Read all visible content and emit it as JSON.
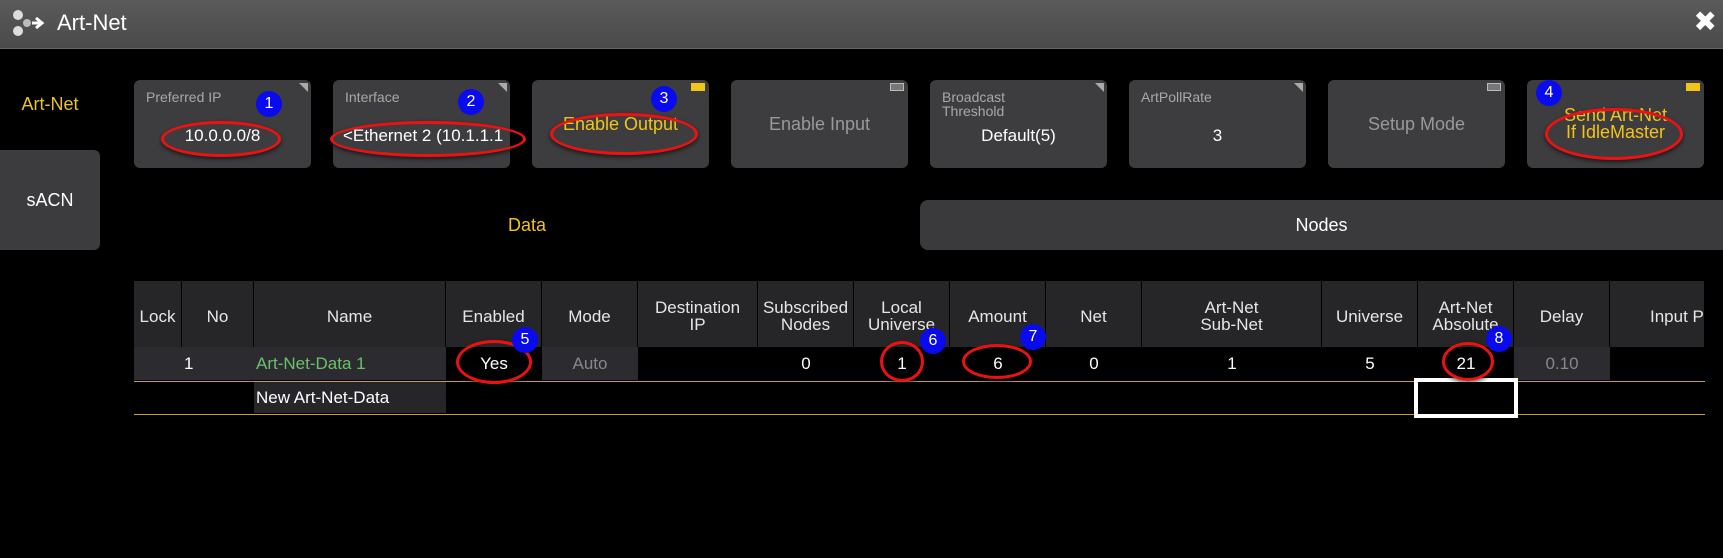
{
  "window": {
    "title": "Art-Net",
    "icon": "art-net-app-icon",
    "close": "✖"
  },
  "sidebar": {
    "items": [
      {
        "label": "Art-Net",
        "active": true
      },
      {
        "label": "sACN",
        "active": false
      }
    ]
  },
  "buttons": {
    "preferred_ip": {
      "label": "Preferred IP",
      "value": "10.0.0.0/8"
    },
    "interface": {
      "label": "Interface",
      "value": "<Ethernet 2 (10.1.1.1"
    },
    "enable_output": {
      "label": "Enable Output",
      "state": "on"
    },
    "enable_input": {
      "label": "Enable Input",
      "state": "off"
    },
    "broadcast_threshold": {
      "label": "Broadcast Threshold",
      "value": "Default(5)"
    },
    "artpoll_rate": {
      "label": "ArtPollRate",
      "value": "3"
    },
    "setup_mode": {
      "label": "Setup Mode",
      "state": "off"
    },
    "send_artnet": {
      "label_line1": "Send Art-Net",
      "label_line2": "If IdleMaster",
      "state": "on"
    }
  },
  "tabs": {
    "data": "Data",
    "nodes": "Nodes"
  },
  "table": {
    "headers": {
      "lock": "Lock",
      "no": "No",
      "name": "Name",
      "enabled": "Enabled",
      "mode": "Mode",
      "dest_ip_1": "Destination",
      "dest_ip_2": "IP",
      "subscribed_1": "Subscribed",
      "subscribed_2": "Nodes",
      "local_universe_1": "Local",
      "local_universe_2": "Universe",
      "amount": "Amount",
      "net": "Net",
      "subnet_1": "Art-Net",
      "subnet_2": "Sub-Net",
      "universe": "Universe",
      "absolute_1": "Art-Net",
      "absolute_2": "Absolute",
      "delay": "Delay",
      "input_p": "Input P"
    },
    "row": {
      "lock": "",
      "no": "1",
      "name": "Art-Net-Data 1",
      "enabled": "Yes",
      "mode": "Auto",
      "destination_ip": "",
      "subscribed_nodes": "0",
      "local_universe": "1",
      "amount": "6",
      "net": "0",
      "sub_net": "1",
      "universe": "5",
      "absolute": "21",
      "delay": "0.10",
      "input_p": ""
    },
    "new_row_label": "New Art-Net-Data"
  },
  "annotations": [
    "1",
    "2",
    "3",
    "4",
    "5",
    "6",
    "7",
    "8"
  ],
  "colors": {
    "accent": "#f0c419",
    "name_green": "#6cc06c",
    "badge_blue": "#0a0aee",
    "highlight_red": "#e11111"
  }
}
